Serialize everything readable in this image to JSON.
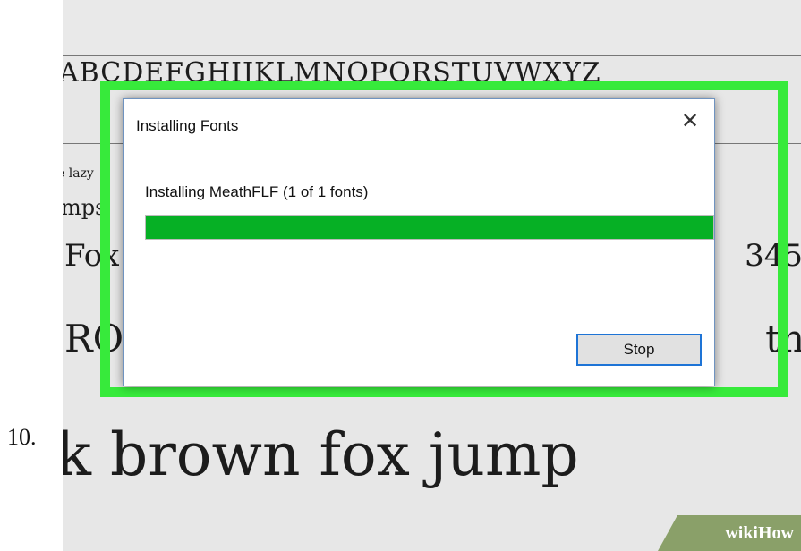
{
  "step_number": "10.",
  "background": {
    "alphabet": "ABCDEFGHIJKLMNOPQRSTUVWXYZ",
    "samples": [
      "e lazy",
      "mps",
      "Fox",
      "RO",
      "k brown fox jump"
    ],
    "right_fragments": [
      "345",
      "th"
    ]
  },
  "dialog": {
    "title": "Installing Fonts",
    "close_symbol": "✕",
    "status": "Installing MeathFLF (1 of 1 fonts)",
    "progress_fraction": 1.0,
    "stop_label": "Stop"
  },
  "watermark": {
    "prefix": "wiki",
    "suffix": "How"
  },
  "colors": {
    "highlight_border": "#37ea3b",
    "progress_fill": "#06b025",
    "button_focus": "#1e74d6"
  }
}
